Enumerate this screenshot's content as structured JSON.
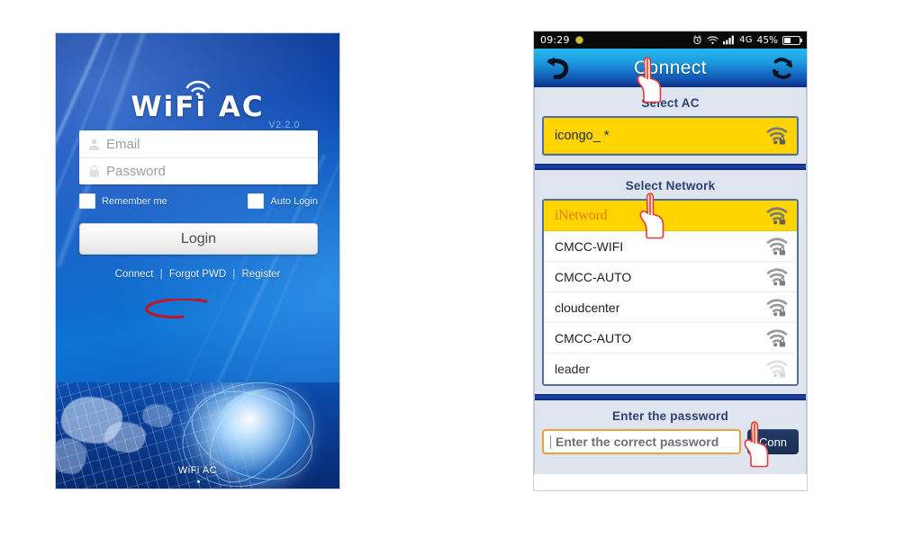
{
  "login_screen": {
    "brand": {
      "title": "WiFi AC",
      "wifi_icon": "wifi-arc-icon",
      "version": "V2.2.0"
    },
    "fields": [
      {
        "name": "email",
        "icon": "person-icon",
        "placeholder": "Email",
        "value": ""
      },
      {
        "name": "password",
        "icon": "lock-icon",
        "placeholder": "Password",
        "value": ""
      }
    ],
    "checkboxes": [
      {
        "name": "remember-me",
        "label": "Remember me",
        "checked": false
      },
      {
        "name": "auto-login",
        "label": "Auto Login",
        "checked": false
      }
    ],
    "login_button": "Login",
    "links": [
      {
        "name": "connect",
        "label": "Connect"
      },
      {
        "name": "forgot-pwd",
        "label": "Forgot PWD"
      },
      {
        "name": "register",
        "label": "Register"
      }
    ],
    "link_separator": "|",
    "footer_caption": "WiFi AC",
    "annotation": {
      "type": "red-ellipse-highlight",
      "targets": "Connect",
      "color": "#c11722"
    }
  },
  "connect_screen": {
    "status_bar": {
      "time": "09:29",
      "left_icons": [
        "yellow-dot-icon"
      ],
      "right_icons": [
        "alarm-icon",
        "wifi-icon",
        "signal-bars-icon"
      ],
      "network": "4G",
      "battery_percent": "45%",
      "battery_icon": "battery-icon"
    },
    "app_bar": {
      "back_icon": "back-arrow-icon",
      "title": "Connect",
      "refresh_icon": "refresh-icon"
    },
    "select_ac": {
      "title": "Select AC",
      "rows": [
        {
          "label": "icongo_ *",
          "selected": true,
          "icon": "wifi-lock-icon",
          "signal": "full"
        }
      ]
    },
    "select_network": {
      "title": "Select  Network",
      "rows": [
        {
          "label": "iNetword",
          "selected": true,
          "icon": "wifi-lock-icon",
          "signal": "full"
        },
        {
          "label": "CMCC-WIFI",
          "selected": false,
          "icon": "wifi-lock-icon",
          "signal": "full"
        },
        {
          "label": "CMCC-AUTO",
          "selected": false,
          "icon": "wifi-lock-icon",
          "signal": "full"
        },
        {
          "label": "cloudcenter",
          "selected": false,
          "icon": "wifi-lock-icon",
          "signal": "full"
        },
        {
          "label": "CMCC-AUTO",
          "selected": false,
          "icon": "wifi-lock-icon",
          "signal": "full"
        },
        {
          "label": "leader",
          "selected": false,
          "icon": "wifi-lock-icon",
          "signal": "weak"
        }
      ]
    },
    "password_section": {
      "title": "Enter the password",
      "input": {
        "placeholder": "Enter the correct password",
        "value": ""
      },
      "connect_button": "Conn"
    },
    "annotations": [
      {
        "type": "red-hand-pointer",
        "targets": "icongo_ *",
        "color": "#e03a3a"
      },
      {
        "type": "red-hand-pointer",
        "targets": "iNetword",
        "color": "#e03a3a"
      },
      {
        "type": "red-hand-pointer",
        "targets": "Conn",
        "color": "#e03a3a"
      }
    ]
  },
  "colors": {
    "highlight_yellow": "#ffd400",
    "panel_blue_grey": "#dfe5ee",
    "divider_navy": "#10277e",
    "accent_orange": "#e8a33c",
    "annotation_red": "#c11722",
    "app_bar_cyan": "#25b9ef"
  }
}
